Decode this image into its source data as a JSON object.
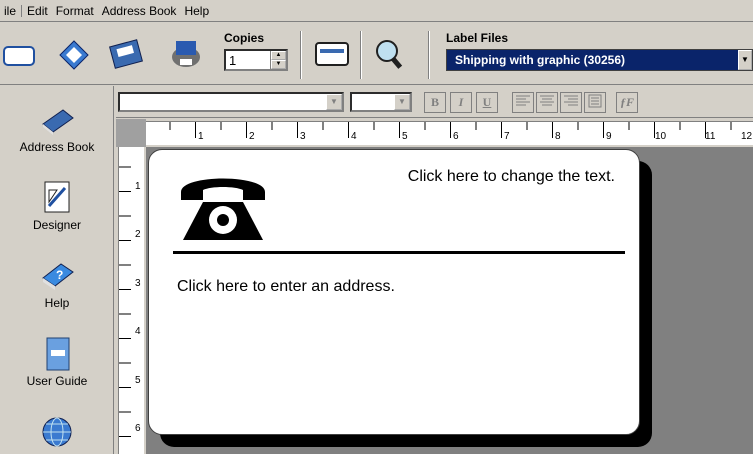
{
  "menu": [
    "ile",
    "Edit",
    "Format",
    "Address Book",
    "Help"
  ],
  "toolbar": {
    "copies_label": "Copies",
    "copies_value": "1",
    "label_files_label": "Label Files",
    "label_files_value": "Shipping with graphic (30256)"
  },
  "sidebar": {
    "items": [
      {
        "label": "Address Book",
        "icon": "address-book-icon"
      },
      {
        "label": "Designer",
        "icon": "designer-icon"
      },
      {
        "label": "Help",
        "icon": "help-icon"
      },
      {
        "label": "User Guide",
        "icon": "user-guide-icon"
      },
      {
        "label": "",
        "icon": "globe-icon"
      }
    ]
  },
  "format": {
    "bold": "B",
    "italic": "I",
    "underline": "U",
    "fx": "ƒF"
  },
  "ruler": {
    "top": [
      "1",
      "2",
      "3",
      "4",
      "5",
      "6",
      "7",
      "8",
      "9",
      "10",
      "11",
      "12"
    ],
    "left": [
      "1",
      "2",
      "3",
      "4",
      "5",
      "6"
    ]
  },
  "label": {
    "change_text": "Click here to change the text.",
    "address_text": "Click here to enter an address."
  }
}
